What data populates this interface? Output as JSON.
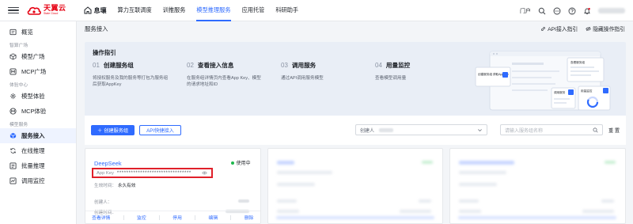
{
  "brand": {
    "name_cn": "天翼云",
    "name_en": "State Cloud",
    "color": "#e60012"
  },
  "accent": "#2f6bff",
  "topnav": {
    "home_label": "息壤",
    "items": [
      {
        "label": "算力互联调度",
        "active": false
      },
      {
        "label": "训推服务",
        "active": false
      },
      {
        "label": "模型推理服务",
        "active": true
      },
      {
        "label": "应用托管",
        "active": false
      },
      {
        "label": "科研助手",
        "active": false
      }
    ],
    "portal_label": "门户"
  },
  "sidebar": {
    "overview": "概览",
    "group_square": "智算广场",
    "model_square": "模型广场",
    "mcp_square": "MCP广场",
    "group_experience": "体验中心",
    "model_experience": "模型体验",
    "mcp_experience": "MCP体验",
    "group_service": "模型服务",
    "service_access": "服务接入",
    "online_inference": "在线推理",
    "batch_inference": "批量推理",
    "call_monitor": "调用监控"
  },
  "page": {
    "title": "服务接入",
    "api_guide_link": "API接入指引",
    "hide_guide_link": "隐藏操作指引"
  },
  "guide": {
    "title": "操作指引",
    "steps": [
      {
        "num": "01",
        "name": "创建服务组",
        "desc": "将授权服务及我的服务等打包为服务组后获取AppKey"
      },
      {
        "num": "02",
        "name": "查看接入信息",
        "desc": "在服务组详情页内查看App Key、模型的请求地址和ID"
      },
      {
        "num": "03",
        "name": "调用服务",
        "desc": "通过API调用服务模型"
      },
      {
        "num": "04",
        "name": "用量监控",
        "desc": "查看模型调用量"
      }
    ],
    "illus_label_1": "创建服务组 获取AppKey",
    "illus_label_2": "查看服务组",
    "illus_label_3": "调用服务",
    "illus_label_4": "用量监控"
  },
  "toolbar": {
    "create_label": "创建服务组",
    "api_quick_label": "API快捷接入",
    "creator_label": "创建人",
    "search_placeholder": "请输入服务组名称",
    "reset_label": "重 置"
  },
  "cards": [
    {
      "name": "DeepSeek",
      "status": "使用中",
      "appkey_label": "App Key",
      "appkey_value": "********************************",
      "valid_label": "生效时间：",
      "valid_value": "永久有效",
      "creator_label": "创建人：",
      "created_label": "创建时间：",
      "actions": [
        "查看详情",
        "监控",
        "停用",
        "编辑",
        "删除"
      ]
    }
  ]
}
